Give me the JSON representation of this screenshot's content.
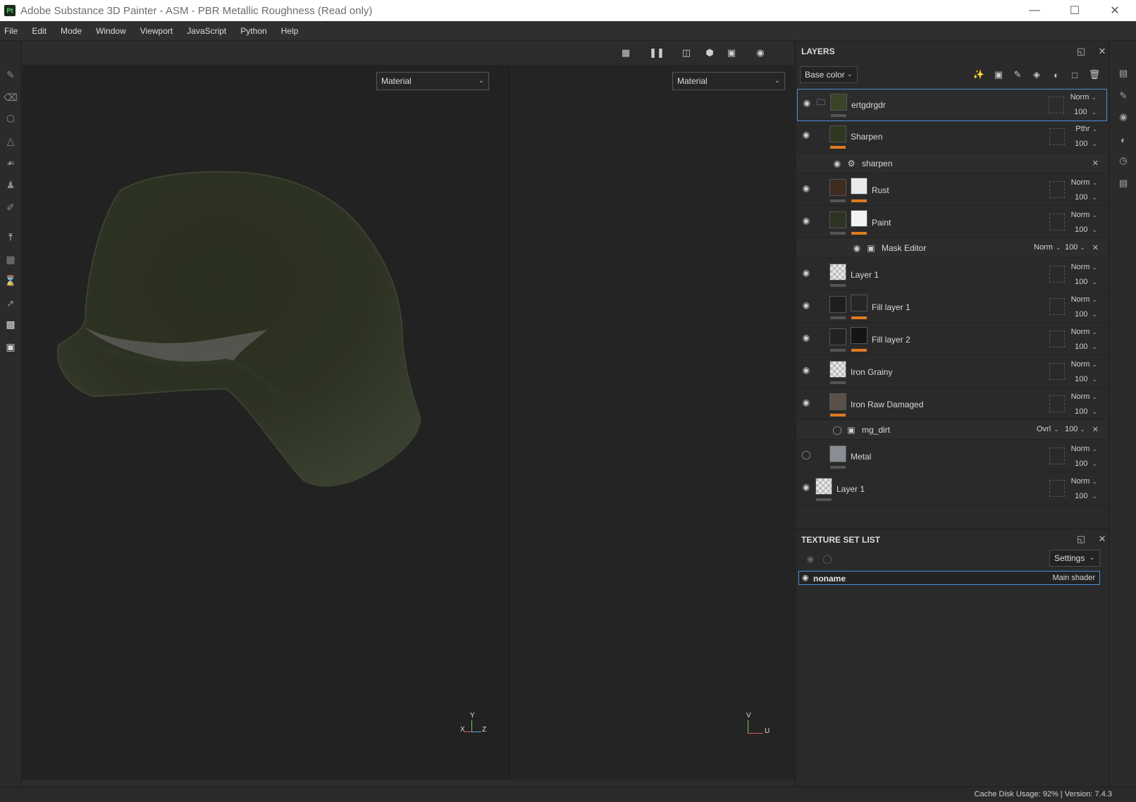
{
  "window": {
    "logo": "Pt",
    "title": "Adobe Substance 3D Painter - ASM - PBR Metallic Roughness (Read only)",
    "minimize_icon": "minimize-icon",
    "maximize_icon": "maximize-icon",
    "close_icon": "close-icon"
  },
  "menu": [
    "File",
    "Edit",
    "Mode",
    "Window",
    "Viewport",
    "JavaScript",
    "Python",
    "Help"
  ],
  "viewport": {
    "left_mode": "Material",
    "right_mode": "Material",
    "axis_3d": {
      "y": "Y",
      "x": "X",
      "z": "Z"
    },
    "axis_2d": {
      "v": "V",
      "u": "U"
    }
  },
  "layers_panel": {
    "title": "LAYERS",
    "channel": "Base color",
    "layers": [
      {
        "name": "ertgdrgdr",
        "blend": "Norm",
        "opacity": "100"
      },
      {
        "name": "Sharpen",
        "blend": "Pthr",
        "opacity": "100"
      },
      {
        "name": "sharpen"
      },
      {
        "name": "Rust",
        "blend": "Norm",
        "opacity": "100"
      },
      {
        "name": "Paint",
        "blend": "Norm",
        "opacity": "100"
      },
      {
        "name": "Mask Editor",
        "blend": "Norm",
        "opacity": "100"
      },
      {
        "name": "Layer 1",
        "blend": "Norm",
        "opacity": "100"
      },
      {
        "name": "Fill layer 1",
        "blend": "Norm",
        "opacity": "100"
      },
      {
        "name": "Fill layer 2",
        "blend": "Norm",
        "opacity": "100"
      },
      {
        "name": "Iron Grainy",
        "blend": "Norm",
        "opacity": "100"
      },
      {
        "name": "Iron Raw Damaged",
        "blend": "Norm",
        "opacity": "100"
      },
      {
        "name": "mg_dirt",
        "blend": "Ovrl",
        "opacity": "100"
      },
      {
        "name": "Metal",
        "blend": "Norm",
        "opacity": "100"
      },
      {
        "name": "Layer 1",
        "blend": "Norm",
        "opacity": "100"
      }
    ]
  },
  "texture_set_list": {
    "title": "TEXTURE SET LIST",
    "settings": "Settings",
    "item_name": "noname",
    "item_shader": "Main shader"
  },
  "status": {
    "text": "Cache Disk Usage:    92% | Version: 7.4.3"
  },
  "colors": {
    "selection_border": "#4a8fd8",
    "mask_bar": "#e07a1f",
    "helmet": "#2f3424"
  }
}
